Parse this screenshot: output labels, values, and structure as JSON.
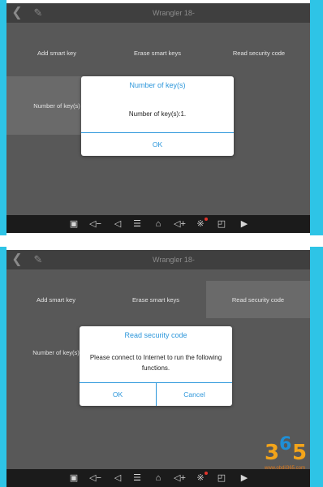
{
  "app": {
    "title": "Wrangler 18-",
    "menu": [
      "Add smart key",
      "Erase smart keys",
      "Read security code",
      "Number of key(s)"
    ]
  },
  "screen1": {
    "dialog": {
      "title": "Number of key(s)",
      "message": "Number of key(s):1.",
      "ok": "OK"
    }
  },
  "screen2": {
    "dialog": {
      "title": "Read security code",
      "message": "Please connect to Internet to run the following functions.",
      "ok": "OK",
      "cancel": "Cancel"
    }
  },
  "navbar": {
    "icons": [
      "screenshot-icon",
      "volume-down-icon",
      "back-icon",
      "menu-icon",
      "home-icon",
      "volume-up-icon",
      "bluetooth-icon",
      "vci-icon",
      "screen-record-icon"
    ]
  },
  "watermark": {
    "text_3": "3",
    "text_6": "6",
    "text_5": "5",
    "url": "www.obdii365.com"
  },
  "colors": {
    "accent": "#2d97db",
    "frame": "#2ec4e6",
    "screen": "#585858",
    "navbar": "#1b1b1b"
  }
}
